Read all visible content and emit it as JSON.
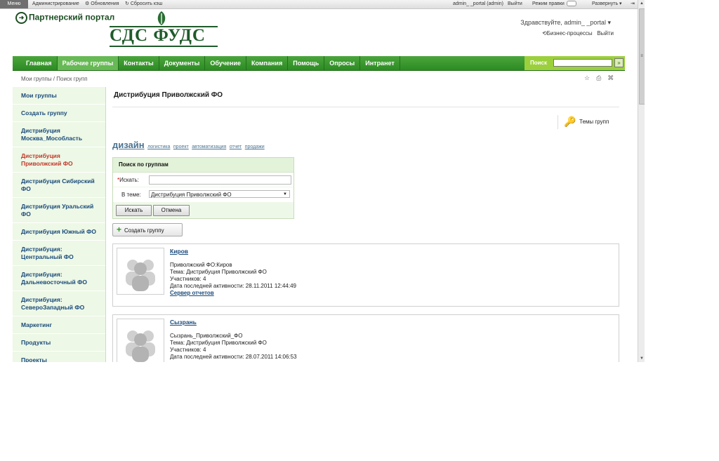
{
  "admin_bar": {
    "menu": "Меню",
    "admin": "Администрирование",
    "updates": "Обновления",
    "reset_cache": "Сбросить кэш",
    "user": "admin_ _portal (admin)",
    "logout": "Выйти",
    "edit_mode": "Режим правки",
    "expand": "Развернуть"
  },
  "header": {
    "portal_title": "Партнерский портал",
    "logo_text": "СДС ФУДС",
    "greeting": "Здравствуйте, admin_ _portal",
    "business_processes": "Бизнес-процессы",
    "logout": "Выйти"
  },
  "nav": {
    "items": [
      "Главная",
      "Рабочие группы",
      "Контакты",
      "Документы",
      "Обучение",
      "Компания",
      "Помощь",
      "Опросы",
      "Интранет"
    ],
    "active_index": 1,
    "search_label": "Поиск",
    "search_go": "»"
  },
  "breadcrumb": "Мои группы / Поиск групп",
  "tools": {
    "star": "☆",
    "print": "⎙",
    "sitemap": "⌘"
  },
  "sidebar": {
    "items": [
      "Мои группы",
      "Создать группу",
      "Дистрибуция Москва_Мособласть",
      "Дистрибуция Приволжский ФО",
      "Дистрибуция Сибирский ФО",
      "Дистрибуция Уральский ФО",
      "Дистрибуция Южный ФО",
      "Дистрибуция: Центральный ФО",
      "Дистрибуция: Дальневосточный ФО",
      "Дистрибуция: СевероЗападный ФО",
      "Маркетинг",
      "Продукты",
      "Проекты"
    ],
    "active_index": 3
  },
  "main": {
    "title": "Дистрибуция Приволжский ФО",
    "themes_label": "Темы групп",
    "tags": {
      "big": "дизайн",
      "small": [
        "логистика",
        "проект",
        "автоматизация",
        "отчет",
        "продажи"
      ]
    },
    "search_form": {
      "header": "Поиск по группам",
      "required_mark": "*",
      "find_label": "Искать:",
      "find_value": "",
      "theme_label": "В теме:",
      "theme_value": "Дистрибуция Приволжский ФО",
      "search_button": "Искать",
      "cancel_button": "Отмена"
    },
    "create_group": "Создать группу",
    "groups": [
      {
        "name": "Киров",
        "description": "Приволжский ФО:Киров",
        "theme": "Тема: Дистрибуция Приволжский ФО",
        "members": "Участников: 4",
        "last_activity": "Дата последней активности: 28.11.2011 12:44:49",
        "link": "Сервер отчетов"
      },
      {
        "name": "Сызрань",
        "description": "Сызрань_Приволжский_ФО",
        "theme": "Тема: Дистрибуция Приволжский ФО",
        "members": "Участников: 4",
        "last_activity": "Дата последней активности: 28.07.2011 14:06:53",
        "link": ""
      }
    ]
  }
}
